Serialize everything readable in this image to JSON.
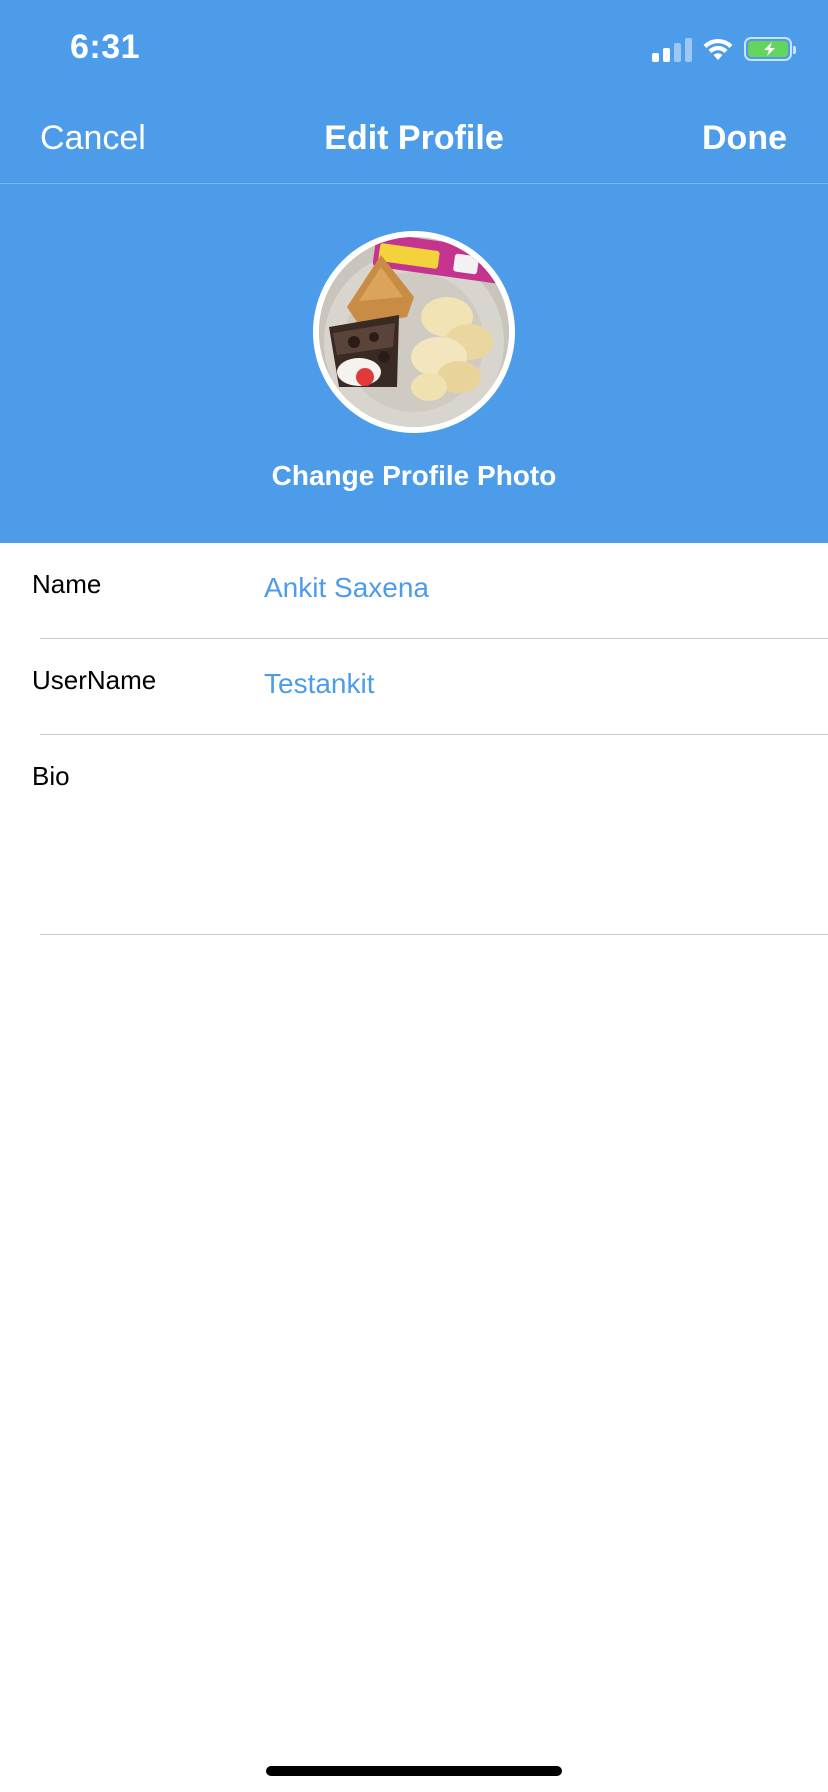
{
  "status_bar": {
    "time": "6:31"
  },
  "nav": {
    "cancel_label": "Cancel",
    "title": "Edit Profile",
    "done_label": "Done"
  },
  "profile": {
    "change_photo_label": "Change Profile Photo"
  },
  "form": {
    "name_label": "Name",
    "name_value": "Ankit Saxena",
    "username_label": "UserName",
    "username_value": "Testankit",
    "bio_label": "Bio",
    "bio_value": ""
  },
  "colors": {
    "accent": "#4d9ce9",
    "header_background": "#4d9ce9",
    "battery_fill": "#63d55d",
    "divider": "#c8c8cc"
  },
  "icons": {
    "signal": "cellular-signal-icon",
    "wifi": "wifi-icon",
    "battery": "battery-charging-icon"
  }
}
